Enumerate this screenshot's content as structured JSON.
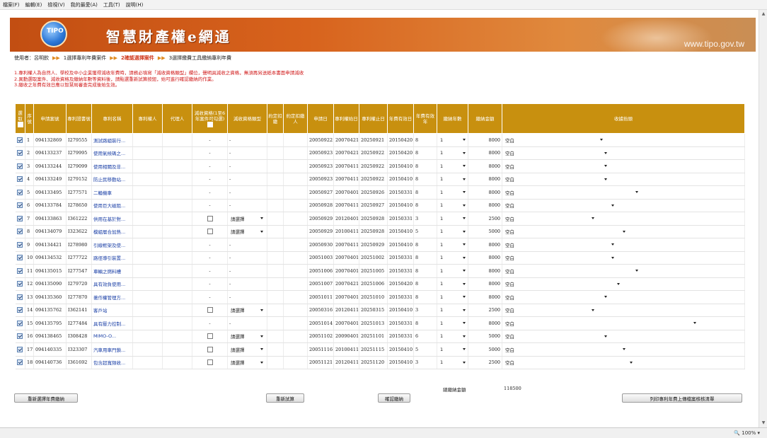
{
  "menu": [
    "檔案(F)",
    "編輯(E)",
    "檢視(V)",
    "我的最愛(A)",
    "工具(T)",
    "說明(H)"
  ],
  "banner": {
    "logo_text": "TIPO",
    "title": "智慧財產權e網通",
    "url": "www.tipo.gov.tw"
  },
  "breadcrumb": {
    "user": "使用者：呂明欽",
    "step1": "1選擇專利年費案件",
    "step2": "2確認選擇案件",
    "step3": "3選擇繳費工具繳納專利年費"
  },
  "notes": [
    "1.專利權人為自然人、學校及中小企業獲得減收年費時，請務必填寫「減收資格類型」欄位，聲明具減收之資格，無須再另送紙本書面申請減收",
    "2.異動選取案件、減收資格及繳納年數等資料後，請點選重新試算按鈕，始可進行確認繳納的作業。",
    "3.繳收之年費有效日應以智慧局審查完成後始生效。"
  ],
  "table": {
    "headers": [
      "選取",
      "序號",
      "申請案號",
      "專利證書號",
      "專利名稱",
      "專利權人",
      "代理人",
      "減收資格(1至6年案件可勾選)",
      "減收資格類型",
      "約定扣繳",
      "約定扣繳人",
      "申請日",
      "專利權始日",
      "專利權止日",
      "年費有效日",
      "年費有效年",
      "繳納年數",
      "繳納金額",
      "收據抬頭"
    ],
    "rows": [
      {
        "seq": "1",
        "app_no": "094132869",
        "cert_no": "I279555",
        "name": "測試路組裝行...",
        "checked": true,
        "reduce_chk": false,
        "reduce_type": "",
        "apply": "20050922",
        "start": "20070421",
        "end": "20250921",
        "valid": "20150420",
        "valid_yr": "8",
        "years": "1",
        "amount": "8000",
        "receipt": "空白"
      },
      {
        "seq": "2",
        "app_no": "094133237",
        "cert_no": "I279995",
        "name": "使用氣候碼之...",
        "checked": true,
        "reduce_chk": false,
        "reduce_type": "",
        "apply": "20050923",
        "start": "20070421",
        "end": "20250922",
        "valid": "20150420",
        "valid_yr": "8",
        "years": "1",
        "amount": "8000",
        "receipt": "空白"
      },
      {
        "seq": "3",
        "app_no": "094133244",
        "cert_no": "I279099",
        "name": "使用相關及非...",
        "checked": true,
        "reduce_chk": false,
        "reduce_type": "",
        "apply": "20050923",
        "start": "20070411",
        "end": "20250922",
        "valid": "20150410",
        "valid_yr": "8",
        "years": "1",
        "amount": "8000",
        "receipt": "空白"
      },
      {
        "seq": "4",
        "app_no": "094133249",
        "cert_no": "I279152",
        "name": "防止民移動站...",
        "checked": true,
        "reduce_chk": false,
        "reduce_type": "",
        "apply": "20050923",
        "start": "20070411",
        "end": "20250922",
        "valid": "20150410",
        "valid_yr": "8",
        "years": "1",
        "amount": "8000",
        "receipt": "空白"
      },
      {
        "seq": "5",
        "app_no": "094133495",
        "cert_no": "I277571",
        "name": "二輪機車",
        "checked": true,
        "reduce_chk": false,
        "reduce_type": "",
        "apply": "20050927",
        "start": "20070401",
        "end": "20250926",
        "valid": "20150331",
        "valid_yr": "8",
        "years": "1",
        "amount": "8000",
        "receipt": "空白"
      },
      {
        "seq": "6",
        "app_no": "094133784",
        "cert_no": "I278650",
        "name": "使用巨大磁阻...",
        "checked": true,
        "reduce_chk": false,
        "reduce_type": "",
        "apply": "20050928",
        "start": "20070411",
        "end": "20250927",
        "valid": "20150410",
        "valid_yr": "8",
        "years": "1",
        "amount": "8000",
        "receipt": "空白"
      },
      {
        "seq": "7",
        "app_no": "094133863",
        "cert_no": "I361222",
        "name": "供用在基於對...",
        "checked": true,
        "reduce_chk": true,
        "reduce_type": "請選擇",
        "apply": "20050929",
        "start": "20120401",
        "end": "20250928",
        "valid": "20150331",
        "valid_yr": "3",
        "years": "1",
        "amount": "2500",
        "receipt": "空白"
      },
      {
        "seq": "8",
        "app_no": "094134079",
        "cert_no": "I323622",
        "name": "模組層合加熱...",
        "checked": true,
        "reduce_chk": true,
        "reduce_type": "請選擇",
        "apply": "20050929",
        "start": "20100411",
        "end": "20250928",
        "valid": "20150410",
        "valid_yr": "5",
        "years": "1",
        "amount": "5000",
        "receipt": "空白"
      },
      {
        "seq": "9",
        "app_no": "094134421",
        "cert_no": "I278980",
        "name": "引線框架及使...",
        "checked": true,
        "reduce_chk": false,
        "reduce_type": "",
        "apply": "20050930",
        "start": "20070411",
        "end": "20250929",
        "valid": "20150410",
        "valid_yr": "8",
        "years": "1",
        "amount": "8000",
        "receipt": "空白"
      },
      {
        "seq": "10",
        "app_no": "094134532",
        "cert_no": "I277722",
        "name": "路徑導引裝置...",
        "checked": true,
        "reduce_chk": false,
        "reduce_type": "",
        "apply": "20051003",
        "start": "20070401",
        "end": "20251002",
        "valid": "20150331",
        "valid_yr": "8",
        "years": "1",
        "amount": "8000",
        "receipt": "空白"
      },
      {
        "seq": "11",
        "app_no": "094135015",
        "cert_no": "I277547",
        "name": "車輛之燃料槽",
        "checked": true,
        "reduce_chk": false,
        "reduce_type": "",
        "apply": "20051006",
        "start": "20070401",
        "end": "20251005",
        "valid": "20150331",
        "valid_yr": "8",
        "years": "1",
        "amount": "8000",
        "receipt": "空白"
      },
      {
        "seq": "12",
        "app_no": "094135090",
        "cert_no": "I279720",
        "name": "具有效負使用...",
        "checked": true,
        "reduce_chk": false,
        "reduce_type": "",
        "apply": "20051007",
        "start": "20070421",
        "end": "20251006",
        "valid": "20150420",
        "valid_yr": "8",
        "years": "1",
        "amount": "8000",
        "receipt": "空白"
      },
      {
        "seq": "13",
        "app_no": "094135360",
        "cert_no": "I277870",
        "name": "著作權管理方...",
        "checked": true,
        "reduce_chk": false,
        "reduce_type": "",
        "apply": "20051011",
        "start": "20070401",
        "end": "20251010",
        "valid": "20150331",
        "valid_yr": "8",
        "years": "1",
        "amount": "8000",
        "receipt": "空白"
      },
      {
        "seq": "14",
        "app_no": "094135762",
        "cert_no": "I362141",
        "name": "客戶站",
        "checked": true,
        "reduce_chk": true,
        "reduce_type": "請選擇",
        "apply": "20050316",
        "start": "20120411",
        "end": "20250315",
        "valid": "20150410",
        "valid_yr": "3",
        "years": "1",
        "amount": "2500",
        "receipt": "空白"
      },
      {
        "seq": "15",
        "app_no": "094135795",
        "cert_no": "I277484",
        "name": "具有壓力控制...",
        "checked": true,
        "reduce_chk": false,
        "reduce_type": "",
        "apply": "20051014",
        "start": "20070401",
        "end": "20251013",
        "valid": "20150331",
        "valid_yr": "8",
        "years": "1",
        "amount": "8000",
        "receipt": "空白"
      },
      {
        "seq": "16",
        "app_no": "094138465",
        "cert_no": "I308428",
        "name": "MIMO-O...",
        "checked": true,
        "reduce_chk": true,
        "reduce_type": "請選擇",
        "apply": "20051102",
        "start": "20090401",
        "end": "20251101",
        "valid": "20150331",
        "valid_yr": "6",
        "years": "1",
        "amount": "5000",
        "receipt": "空白"
      },
      {
        "seq": "17",
        "app_no": "094140335",
        "cert_no": "I323307",
        "name": "汽車用車門鎖...",
        "checked": true,
        "reduce_chk": true,
        "reduce_type": "請選擇",
        "apply": "20051116",
        "start": "20100411",
        "end": "20251115",
        "valid": "20150410",
        "valid_yr": "5",
        "years": "1",
        "amount": "5000",
        "receipt": "空白"
      },
      {
        "seq": "18",
        "app_no": "094140736",
        "cert_no": "I361692",
        "name": "包含超寬頻收...",
        "checked": true,
        "reduce_chk": true,
        "reduce_type": "請選擇",
        "apply": "20051121",
        "start": "20120411",
        "end": "20251120",
        "valid": "20150410",
        "valid_yr": "3",
        "years": "1",
        "amount": "2500",
        "receipt": "空白"
      }
    ]
  },
  "summary": {
    "label": "總繳納金額",
    "value": "118500"
  },
  "buttons": {
    "reselect": "重新選擇年費繳納",
    "recalc": "重新試算",
    "confirm": "確認繳納",
    "print": "列印專利年費上傳檔案核核清單"
  },
  "status": {
    "zoom": "100%"
  }
}
